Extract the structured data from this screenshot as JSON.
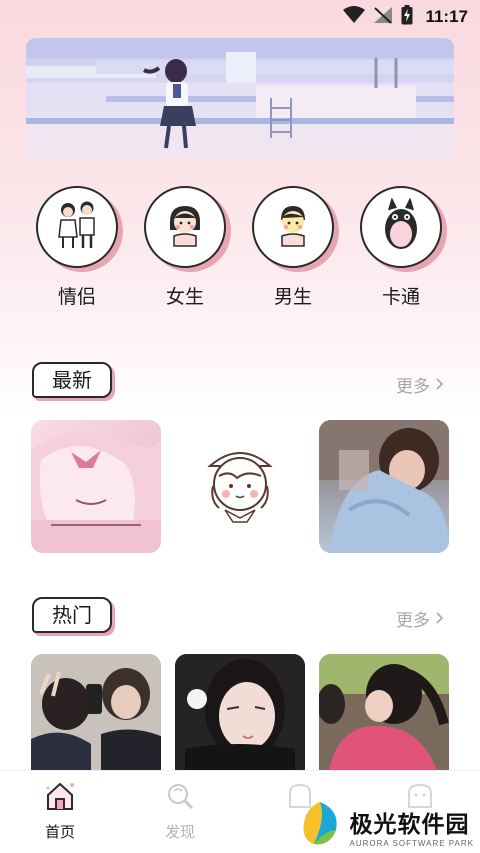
{
  "status_bar": {
    "time": "11:17",
    "icons": [
      "wifi-icon",
      "no-signal-icon",
      "battery-charging-icon"
    ]
  },
  "banner": {
    "image": "anime-girl-poolside-illustration"
  },
  "categories": [
    {
      "label": "情侣",
      "icon": "couple-icon"
    },
    {
      "label": "女生",
      "icon": "girl-icon"
    },
    {
      "label": "男生",
      "icon": "boy-icon"
    },
    {
      "label": "卡通",
      "icon": "totoro-icon"
    }
  ],
  "sections": {
    "latest": {
      "title": "最新",
      "more": "更多",
      "items": [
        "anime-pink-sleeping-girl",
        "cartoon-girl-beret-sketch",
        "girl-blue-sweater-photo"
      ]
    },
    "hot": {
      "title": "热门",
      "more": "更多",
      "items": [
        "girls-peace-sign-photo",
        "girl-winking-photo",
        "girl-hiding-face-photo"
      ]
    }
  },
  "bottom_nav": [
    {
      "label": "首页",
      "active": true
    },
    {
      "label": "发现",
      "active": false
    },
    {
      "label": "",
      "active": false
    },
    {
      "label": "",
      "active": false
    }
  ],
  "watermark": {
    "title": "极光软件园",
    "subtitle": "AURORA SOFTWARE PARK"
  },
  "colors": {
    "accent_pink": "#e7a5b4",
    "outline": "#2a2a2a",
    "muted": "#a8a8a8"
  }
}
